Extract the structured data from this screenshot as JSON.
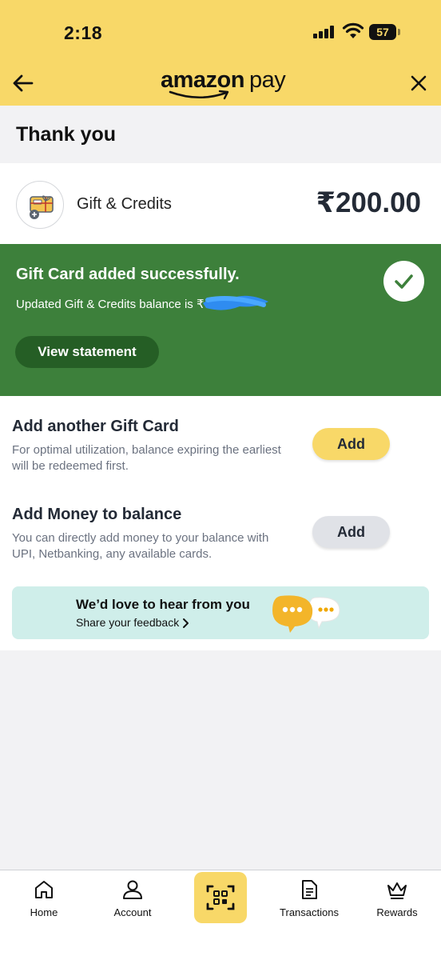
{
  "status_bar": {
    "time": "2:18",
    "battery": "57"
  },
  "app_bar": {
    "brand_1": "amazon",
    "brand_2": "pay"
  },
  "header": {
    "title": "Thank you"
  },
  "credit": {
    "label": "Gift & Credits",
    "amount": "₹200.00"
  },
  "success": {
    "title": "Gift Card added successfully.",
    "subtitle": "Updated Gift & Credits balance is ₹",
    "button": "View statement"
  },
  "options": [
    {
      "title": "Add another Gift Card",
      "description": "For optimal utilization, balance expiring the earliest will be redeemed first.",
      "button": "Add"
    },
    {
      "title": "Add Money to balance",
      "description": "You can directly add money to your balance with UPI, Netbanking, any available cards.",
      "button": "Add"
    }
  ],
  "feedback": {
    "title": "We’d love to hear from you",
    "subtitle": "Share your feedback"
  },
  "nav": {
    "home": "Home",
    "account": "Account",
    "transactions": "Transactions",
    "rewards": "Rewards"
  },
  "colors": {
    "brand_yellow": "#f8d868",
    "success_green": "#3d803b",
    "success_button": "#255e25",
    "feedback_bg": "#cfeeea"
  }
}
